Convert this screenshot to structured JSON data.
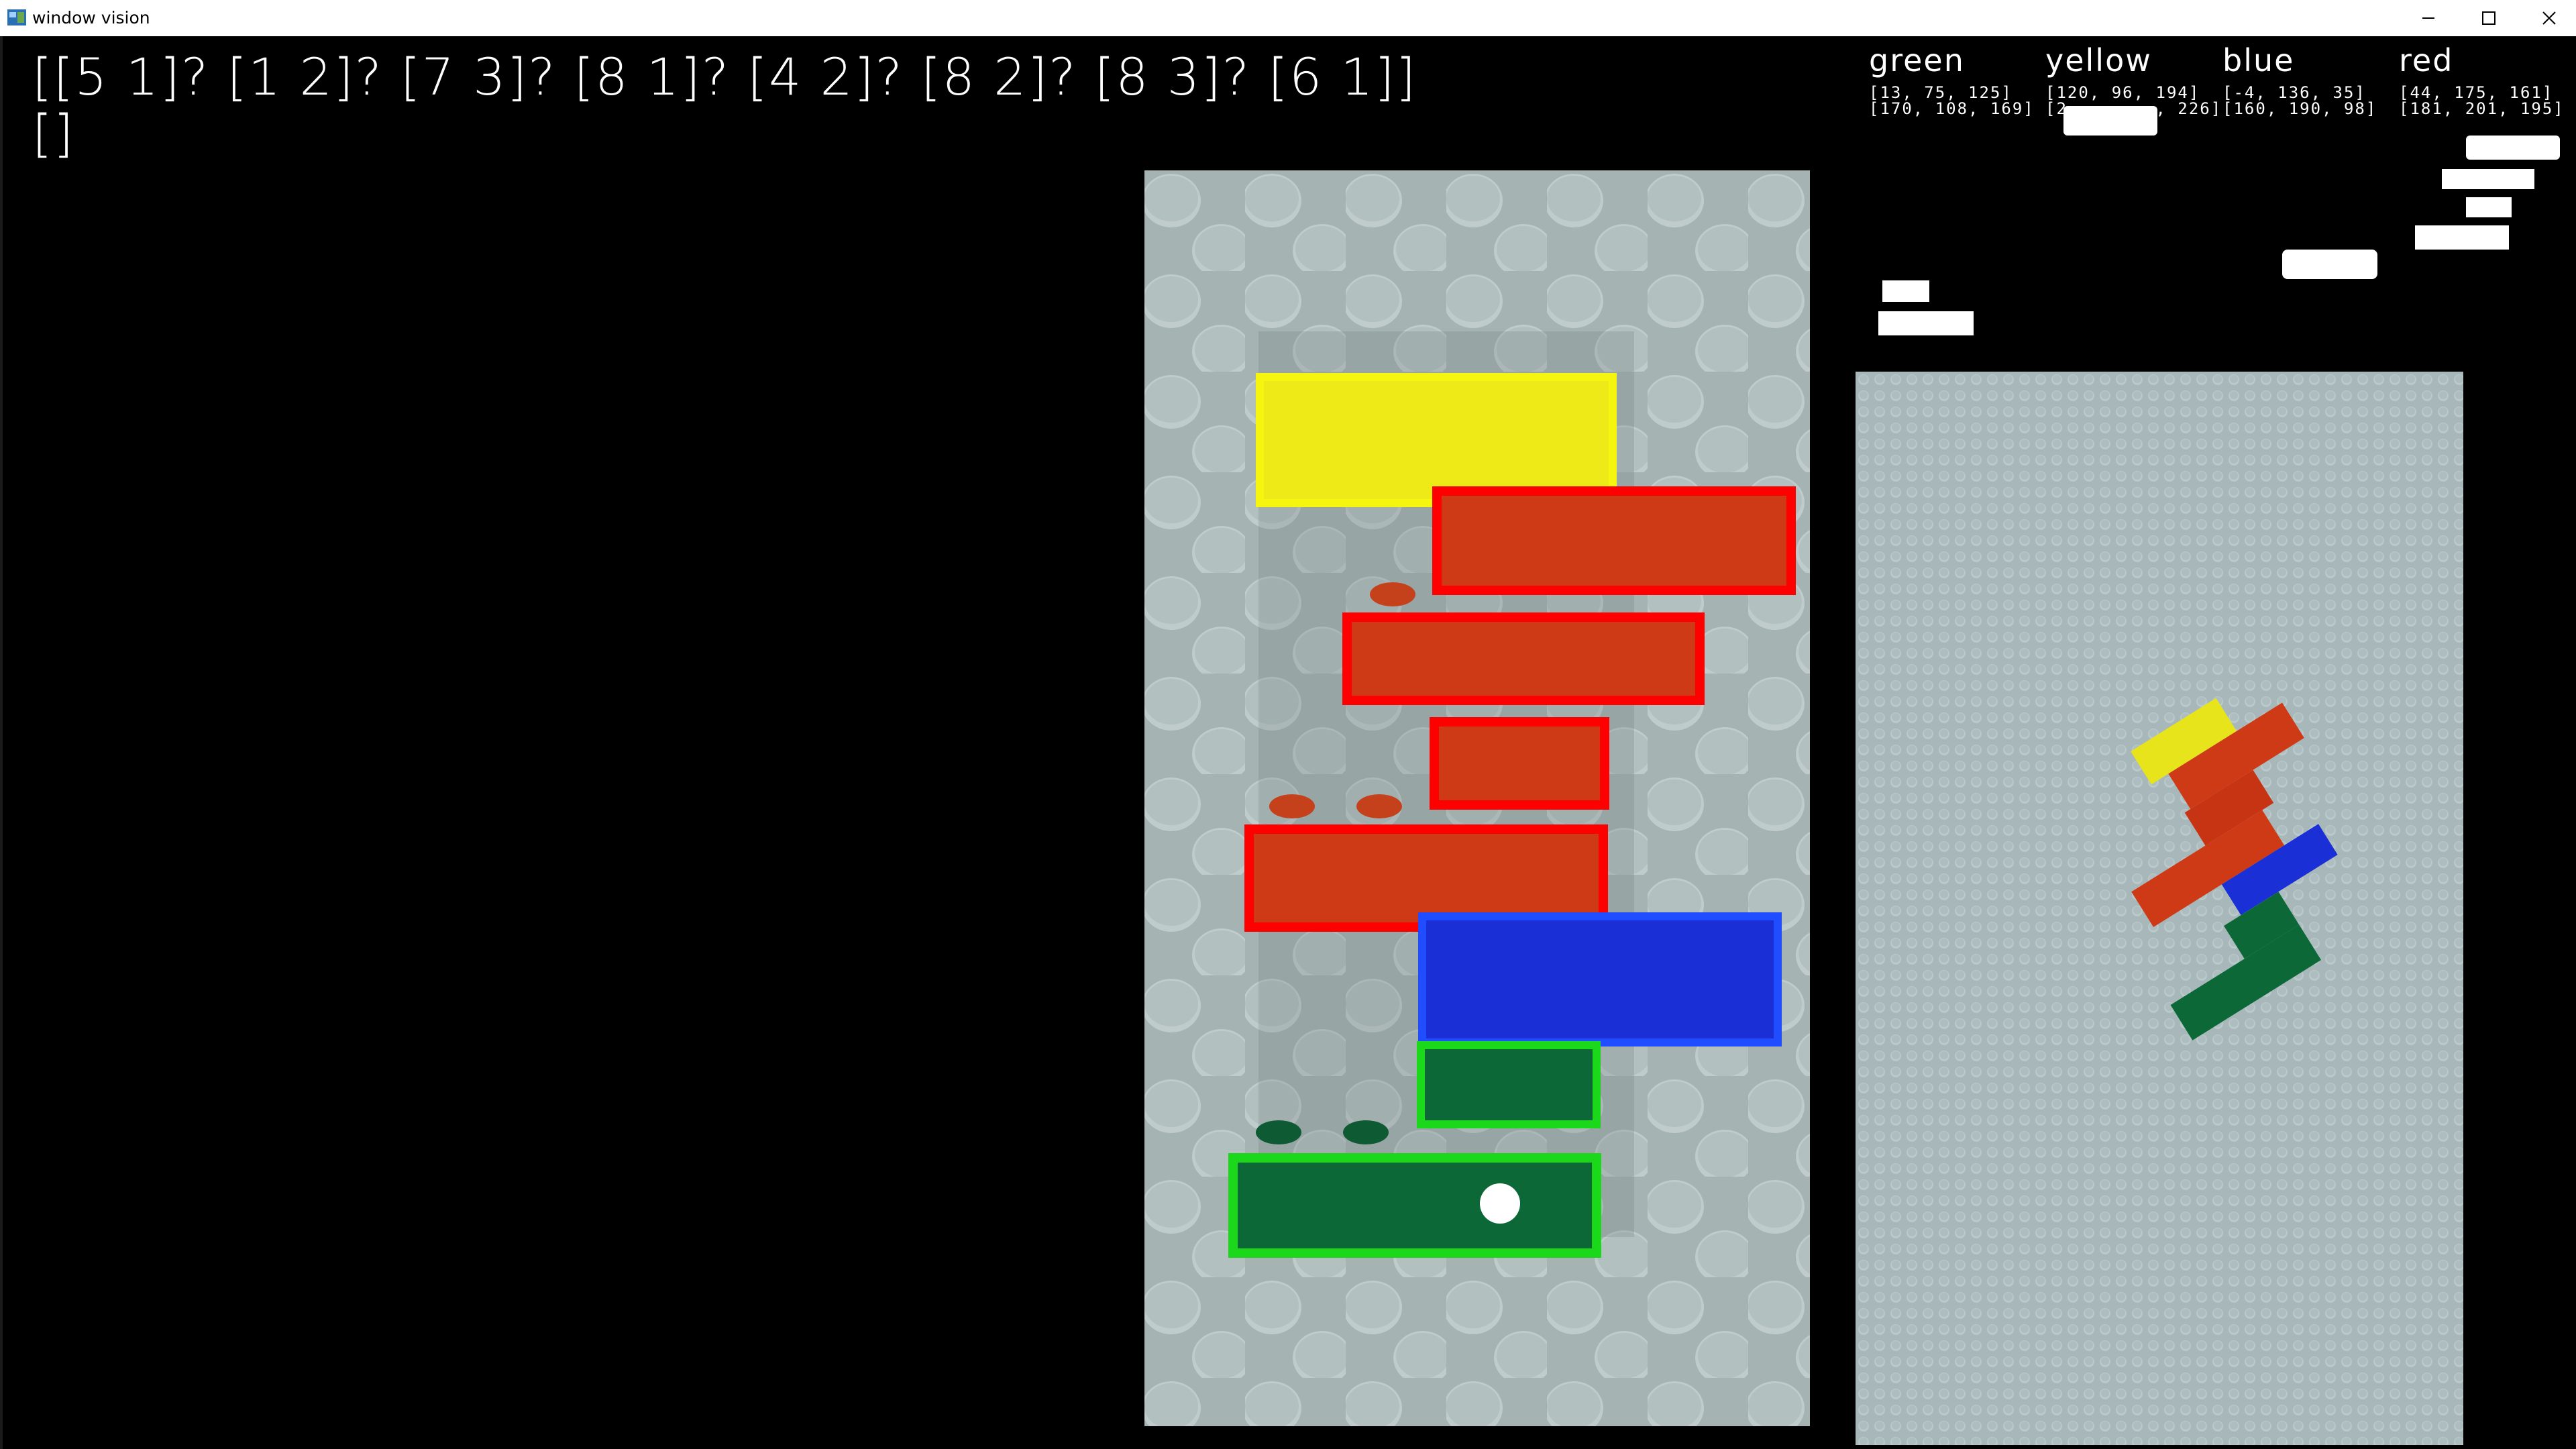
{
  "window": {
    "title": "window vision",
    "icons": {
      "app": "app-icon",
      "minimize": "minimize-icon",
      "maximize": "maximize-icon",
      "close": "close-icon"
    }
  },
  "detection": {
    "list_line1": "[[5 1]? [1 2]? [7 3]? [8 1]? [4 2]? [8 2]? [8 3]? [6 1]]",
    "list_line2": "[]"
  },
  "hsv_ranges": [
    {
      "name": "green",
      "lower": "[13, 75, 125]",
      "upper": "[170, 108, 169]"
    },
    {
      "name": "yellow",
      "lower": "[120, 96, 194]",
      "upper": "[2..., ..., 226]"
    },
    {
      "name": "blue",
      "lower": "[-4, 136, 35]",
      "upper": "[160, 190, 98]"
    },
    {
      "name": "red",
      "lower": "[44, 175, 161]",
      "upper": "[181, 201, 195]"
    }
  ],
  "colors": {
    "yellow": "#f2ee1a",
    "red": "#ff0000",
    "brick_red": "#d03a18",
    "blue": "#1a2fd8",
    "blue_outline": "#1f4dff",
    "green": "#0e6a3a",
    "green_outline": "#19d819",
    "baseplate": "#a7b5b5",
    "stud": "#bcc8c8",
    "board": "#a9b9bb"
  }
}
